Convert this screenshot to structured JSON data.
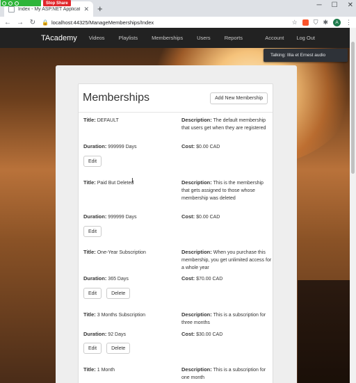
{
  "browser": {
    "share": {
      "stop_label": "Stop Share"
    },
    "tab": {
      "title": "Index - My ASP.NET Application"
    },
    "url": "localhost:44325/ManageMemberships/Index",
    "profile_initial": "A"
  },
  "nav": {
    "brand": "TAcademy",
    "links": [
      "Videos",
      "Playlists",
      "Memberships",
      "Users",
      "Reports"
    ],
    "account": "Account",
    "logout": "Log Out"
  },
  "notification": "Talking: Illia et Ernest audio",
  "panel": {
    "title": "Memberships",
    "add_button": "Add New Membership"
  },
  "labels": {
    "title": "Title:",
    "description": "Description:",
    "duration": "Duration:",
    "cost": "Cost:",
    "edit": "Edit",
    "delete": "Delete"
  },
  "memberships": [
    {
      "title": "DEFAULT",
      "description": "The default membership that users get when they are registered",
      "duration": "999999 Days",
      "cost": "$0.00 CAD"
    },
    {
      "title": "Paid But Deleted",
      "description": "This is the membership that gets assigned to those whose membership was deleted",
      "duration": "999999 Days",
      "cost": "$0.00 CAD"
    },
    {
      "title": "One-Year Subscription",
      "description": "When you purchase this membership, you get unlimited access for a whole year",
      "duration": "365 Days",
      "cost": "$70.00 CAD"
    },
    {
      "title": "3 Months Subscription",
      "description": "This is a subscription for three months",
      "duration": "92 Days",
      "cost": "$30.00 CAD"
    },
    {
      "title": "1 Month",
      "description": "This is a subscription for one month"
    }
  ],
  "colors": {
    "navbar": "#222222",
    "share_green": "#2fb53a",
    "stop_red": "#e0262b"
  }
}
